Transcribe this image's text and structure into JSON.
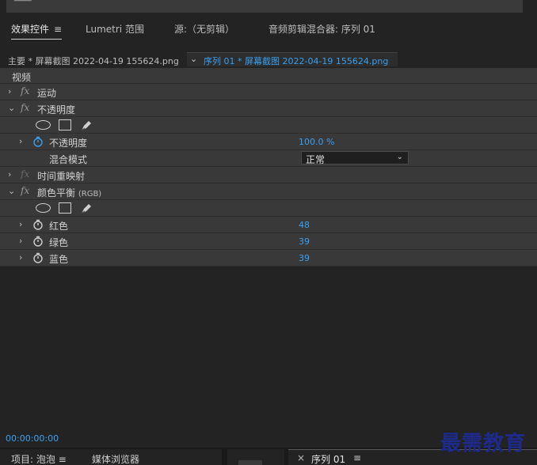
{
  "tabs": [
    {
      "label": "效果控件",
      "menu": "≡",
      "active": true
    },
    {
      "label": "Lumetri 范围"
    },
    {
      "label": "源:（无剪辑）"
    },
    {
      "label": "音频剪辑混合器: 序列 01"
    }
  ],
  "clip_header": {
    "master": "主要 * 屏幕截图 2022-04-19  155624.png",
    "sequence": "序列 01 * 屏幕截图 2022-04-19  155624.png"
  },
  "section_label": "视频",
  "effects": {
    "motion": "运动",
    "opacity": "不透明度",
    "opacity_param": {
      "label": "不透明度",
      "value": "100.0 %"
    },
    "blend_mode": {
      "label": "混合模式",
      "value": "正常"
    },
    "time_remap": "时间重映射",
    "color_balance": "颜色平衡",
    "color_balance_suffix": "(RGB)",
    "red": {
      "label": "红色",
      "value": "48"
    },
    "green": {
      "label": "绿色",
      "value": "39"
    },
    "blue": {
      "label": "蓝色",
      "value": "39"
    }
  },
  "fx_symbol": "fx",
  "timecode": "00:00:00:00",
  "bottom_tabs": {
    "project": "项目: 泡泡",
    "project_menu": "≡",
    "media_browser": "媒体浏览器",
    "sequence_close": "×",
    "sequence": "序列 01",
    "sequence_menu": "≡"
  },
  "watermark": "最需教育",
  "colors": {
    "accent": "#3aa0ef",
    "panel": "#393939",
    "background": "#232323"
  }
}
